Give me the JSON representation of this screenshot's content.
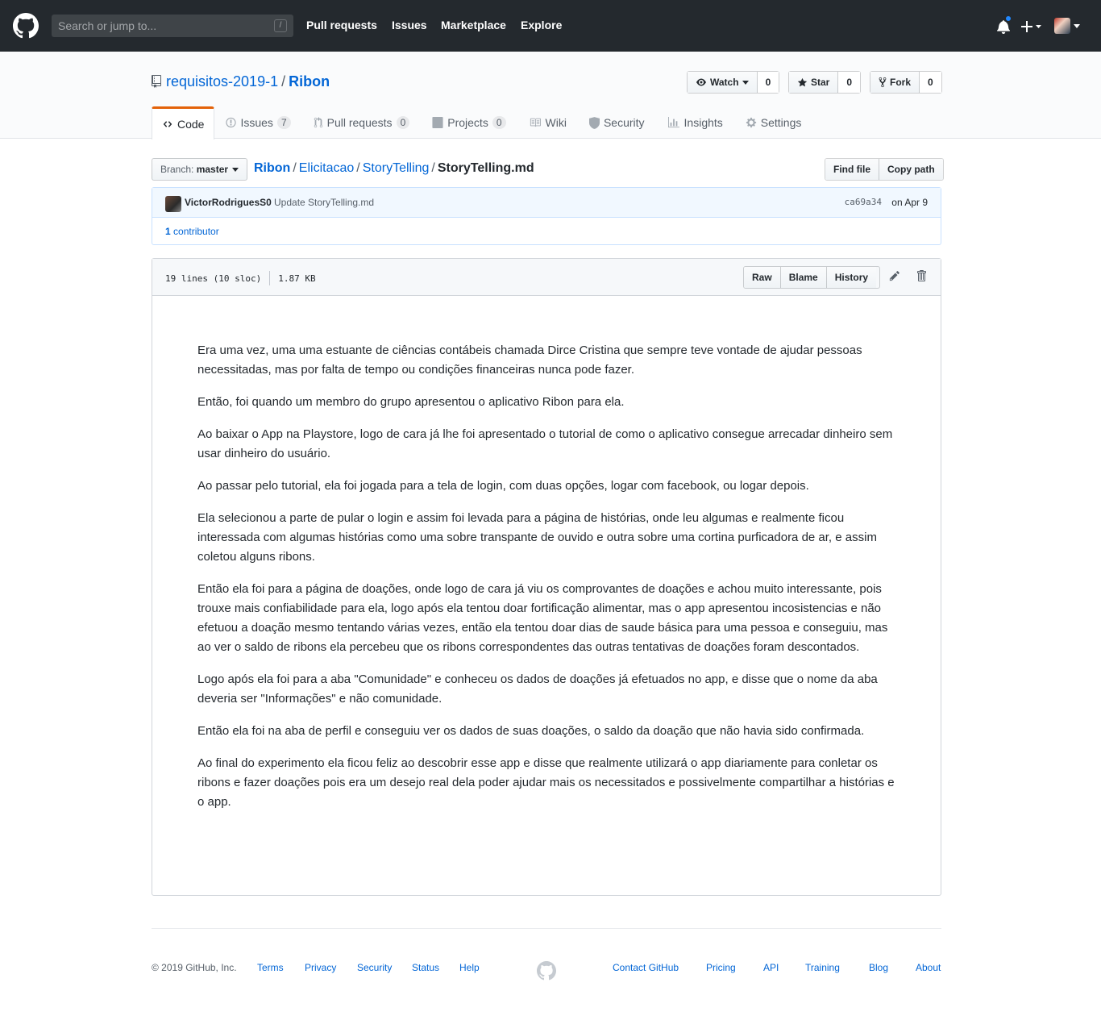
{
  "header": {
    "search_placeholder": "Search or jump to...",
    "search_shortcut": "/",
    "nav": [
      "Pull requests",
      "Issues",
      "Marketplace",
      "Explore"
    ]
  },
  "repo": {
    "owner": "requisitos-2019-1",
    "separator": "/",
    "name": "Ribon",
    "watch_label": "Watch",
    "watch_count": "0",
    "star_label": "Star",
    "star_count": "0",
    "fork_label": "Fork",
    "fork_count": "0"
  },
  "tabs": {
    "code": "Code",
    "issues": "Issues",
    "issues_count": "7",
    "pulls": "Pull requests",
    "pulls_count": "0",
    "projects": "Projects",
    "projects_count": "0",
    "wiki": "Wiki",
    "security": "Security",
    "insights": "Insights",
    "settings": "Settings"
  },
  "file_nav": {
    "branch_prefix": "Branch:",
    "branch": "master",
    "crumbs": [
      "Ribon",
      "Elicitacao",
      "StoryTelling"
    ],
    "separator": "/",
    "filename": "StoryTelling.md",
    "find_file": "Find file",
    "copy_path": "Copy path"
  },
  "commit": {
    "author": "VictorRodriguesS0",
    "message": "Update StoryTelling.md",
    "sha": "ca69a34",
    "date": "on Apr 9",
    "contributors_count": "1",
    "contributors_label": "contributor"
  },
  "file": {
    "lines": "19 lines (10 sloc)",
    "size": "1.87 KB",
    "raw": "Raw",
    "blame": "Blame",
    "history": "History",
    "paragraphs": [
      "Era uma vez, uma uma estuante de ciências contábeis chamada Dirce Cristina que sempre teve vontade de ajudar pessoas necessitadas, mas por falta de tempo ou condições financeiras nunca pode fazer.",
      "Então, foi quando um membro do grupo apresentou o aplicativo Ribon para ela.",
      "Ao baixar o App na Playstore, logo de cara já lhe foi apresentado o tutorial de como o aplicativo consegue arrecadar dinheiro sem usar dinheiro do usuário.",
      "Ao passar pelo tutorial, ela foi jogada para a tela de login, com duas opções, logar com facebook, ou logar depois.",
      "Ela selecionou a parte de pular o login e assim foi levada para a página de histórias, onde leu algumas e realmente ficou interessada com algumas histórias como uma sobre transpante de ouvido e outra sobre uma cortina purficadora de ar, e assim coletou alguns ribons.",
      "Então ela foi para a página de doações, onde logo de cara já viu os comprovantes de doações e achou muito interessante, pois trouxe mais confiabilidade para ela, logo após ela tentou doar fortificação alimentar, mas o app apresentou incosistencias e não efetuou a doação mesmo tentando várias vezes, então ela tentou doar dias de saude básica para uma pessoa e conseguiu, mas ao ver o saldo de ribons ela percebeu que os ribons correspondentes das outras tentativas de doações foram descontados.",
      "Logo após ela foi para a aba \"Comunidade\" e conheceu os dados de doações já efetuados no app, e disse que o nome da aba deveria ser \"Informações\" e não comunidade.",
      "Então ela foi na aba de perfil e conseguiu ver os dados de suas doações, o saldo da doação que não havia sido confirmada.",
      "Ao final do experimento ela ficou feliz ao descobrir esse app e disse que realmente utilizará o app diariamente para conletar os ribons e fazer doações pois era um desejo real dela poder ajudar mais os necessitados e possivelmente compartilhar a histórias e o app."
    ]
  },
  "footer": {
    "copyright": "© 2019 GitHub, Inc.",
    "left_links": [
      "Terms",
      "Privacy",
      "Security",
      "Status",
      "Help"
    ],
    "right_links": [
      "Contact GitHub",
      "Pricing",
      "API",
      "Training",
      "Blog",
      "About"
    ]
  },
  "colors": {
    "header_bg": "#24292e",
    "link": "#0366d6",
    "tab_accent": "#e36209",
    "notification_dot": "#2188ff"
  }
}
